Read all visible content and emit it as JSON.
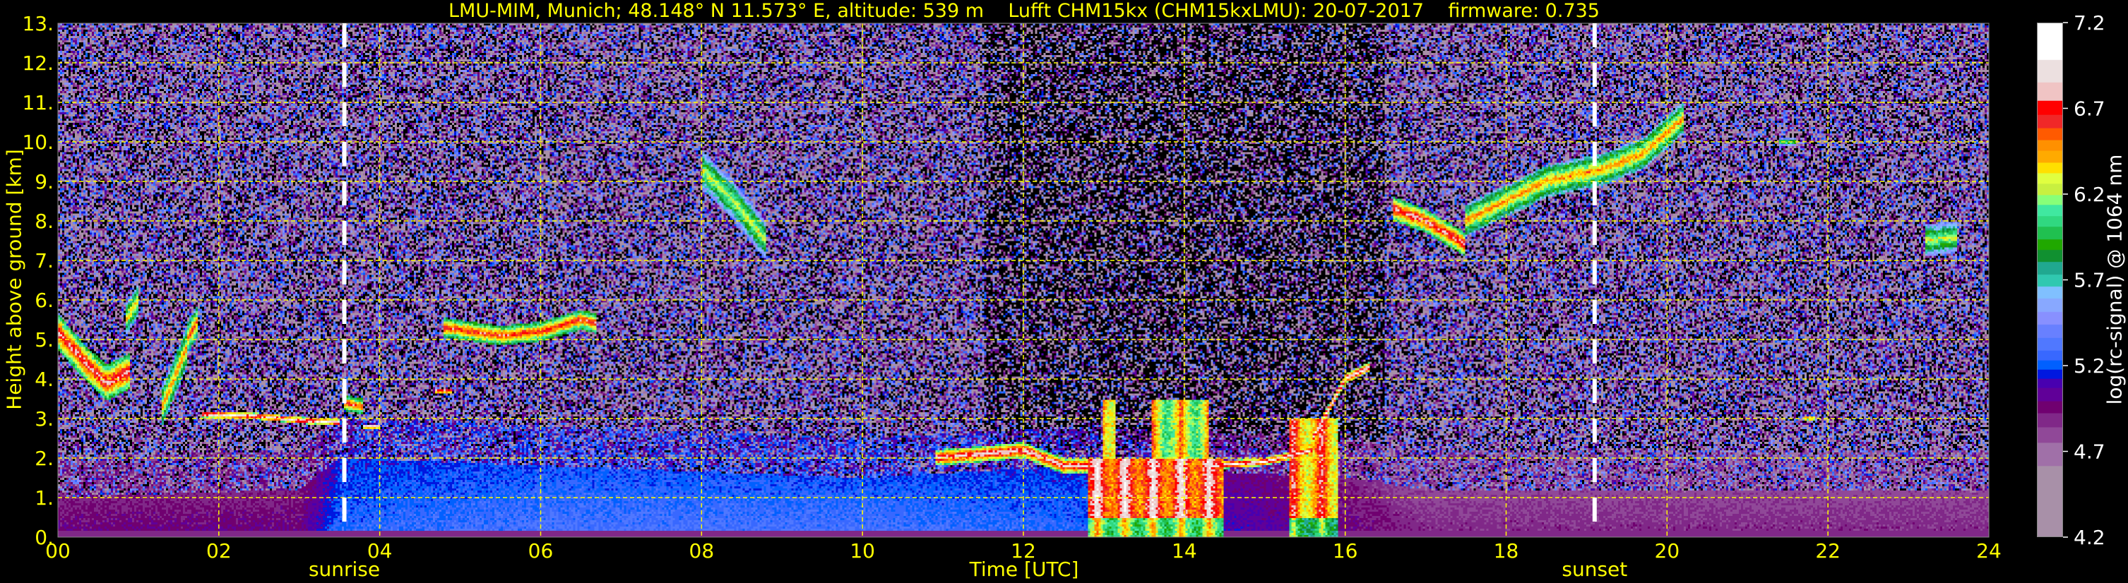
{
  "title": "LMU-MIM, Munich; 48.148° N 11.573° E, altitude: 539 m    Lufft CHM15kx (CHM15kxLMU): 20-07-2017    firmware: 0.735",
  "chart_data": {
    "type": "heatmap",
    "xlabel": "Time [UTC]",
    "ylabel": "Height above ground [km]",
    "xlim": [
      0,
      24
    ],
    "ylim": [
      0,
      13
    ],
    "xticks": [
      0,
      2,
      4,
      6,
      8,
      10,
      12,
      14,
      16,
      18,
      20,
      22,
      24
    ],
    "xtick_labels": [
      "00",
      "02",
      "04",
      "06",
      "08",
      "10",
      "12",
      "14",
      "16",
      "18",
      "20",
      "22",
      "24"
    ],
    "yticks": [
      0,
      1,
      2,
      3,
      4,
      5,
      6,
      7,
      8,
      9,
      10,
      11,
      12,
      13
    ],
    "ytick_labels": [
      "0.",
      "1.",
      "2.",
      "3.",
      "4.",
      "5.",
      "6.",
      "7.",
      "8.",
      "9.",
      "10.",
      "11.",
      "12.",
      "13."
    ],
    "grid": true,
    "grid_color": "#ffff00",
    "annotations": [
      {
        "label": "sunrise",
        "time": 3.56
      },
      {
        "label": "sunset",
        "time": 19.1
      }
    ],
    "colorbar": {
      "label": "log(rc-signal) @ 1064 nm",
      "range": [
        4.2,
        7.2
      ],
      "ticks": [
        4.2,
        4.7,
        5.2,
        5.7,
        6.2,
        6.7,
        7.2
      ],
      "tick_labels": [
        "4.2",
        "4.7",
        "5.2",
        "5.7",
        "6.2",
        "6.7",
        "7.2"
      ],
      "below_color": "#000000",
      "bins": [
        {
          "from": 6.987,
          "color": "#ffffff"
        },
        {
          "from": 6.857,
          "color": "#ece0e0"
        },
        {
          "from": 6.748,
          "color": "#f0c4c4"
        },
        {
          "from": 6.667,
          "color": "#ff0000"
        },
        {
          "from": 6.587,
          "color": "#f02828"
        },
        {
          "from": 6.52,
          "color": "#ff5a00"
        },
        {
          "from": 6.457,
          "color": "#ff9000"
        },
        {
          "from": 6.389,
          "color": "#ffaa00"
        },
        {
          "from": 6.324,
          "color": "#ffe000"
        },
        {
          "from": 6.265,
          "color": "#e0ff40"
        },
        {
          "from": 6.2,
          "color": "#c8f040"
        },
        {
          "from": 6.139,
          "color": "#88ff78"
        },
        {
          "from": 6.076,
          "color": "#40e8a0"
        },
        {
          "from": 6.013,
          "color": "#30d880"
        },
        {
          "from": 5.939,
          "color": "#20c050"
        },
        {
          "from": 5.878,
          "color": "#20a800"
        },
        {
          "from": 5.809,
          "color": "#109030"
        },
        {
          "from": 5.733,
          "color": "#20a890"
        },
        {
          "from": 5.661,
          "color": "#30c8b0"
        },
        {
          "from": 5.591,
          "color": "#80c0ff"
        },
        {
          "from": 5.513,
          "color": "#88a8ff"
        },
        {
          "from": 5.439,
          "color": "#8890ff"
        },
        {
          "from": 5.363,
          "color": "#6880ff"
        },
        {
          "from": 5.287,
          "color": "#5078ff"
        },
        {
          "from": 5.23,
          "color": "#3868ff"
        },
        {
          "from": 5.178,
          "color": "#0060ff"
        },
        {
          "from": 5.124,
          "color": "#0018e0"
        },
        {
          "from": 5.07,
          "color": "#4800b0"
        },
        {
          "from": 4.993,
          "color": "#600098"
        },
        {
          "from": 4.924,
          "color": "#700070"
        },
        {
          "from": 4.841,
          "color": "#802888"
        },
        {
          "from": 4.748,
          "color": "#904898"
        },
        {
          "from": 4.613,
          "color": "#a070a8"
        },
        {
          "from": 4.2,
          "color": "#a890a8"
        }
      ]
    },
    "boundary_layer": [
      [
        0,
        1.0,
        5.0
      ],
      [
        3,
        1.2,
        5.0
      ],
      [
        3.5,
        2.0,
        5.25
      ],
      [
        6,
        1.8,
        5.3
      ],
      [
        10,
        1.5,
        5.3
      ],
      [
        12.7,
        1.8,
        5.25
      ],
      [
        16,
        1.5,
        5.0
      ],
      [
        17,
        1.2,
        4.9
      ],
      [
        24,
        1.2,
        4.9
      ]
    ],
    "cloud_layers": [
      {
        "points": [
          [
            0,
            5.2
          ],
          [
            0.3,
            4.5
          ],
          [
            0.6,
            3.9
          ],
          [
            0.9,
            4.2
          ]
        ],
        "thickness": 0.45,
        "value": 6.8
      },
      {
        "points": [
          [
            0.85,
            5.5
          ],
          [
            1.0,
            6.0
          ]
        ],
        "thickness": 0.4,
        "value": 6.4
      },
      {
        "points": [
          [
            1.3,
            3.3
          ],
          [
            1.6,
            4.8
          ]
        ],
        "thickness": 0.5,
        "value": 6.5
      },
      {
        "points": [
          [
            1.6,
            5.0
          ],
          [
            1.75,
            5.5
          ]
        ],
        "thickness": 0.4,
        "value": 6.6
      },
      {
        "points": [
          [
            1.8,
            3.1
          ],
          [
            2.5,
            3.05
          ],
          [
            3.0,
            2.95
          ],
          [
            3.5,
            2.9
          ]
        ],
        "thickness": 0.08,
        "value": 7.0
      },
      {
        "points": [
          [
            3.55,
            3.4
          ],
          [
            3.8,
            3.3
          ]
        ],
        "thickness": 0.2,
        "value": 6.7
      },
      {
        "points": [
          [
            3.8,
            2.8
          ],
          [
            4.0,
            2.8
          ]
        ],
        "thickness": 0.06,
        "value": 7.0
      },
      {
        "points": [
          [
            4.7,
            3.7
          ],
          [
            4.9,
            3.7
          ]
        ],
        "thickness": 0.05,
        "value": 7.0
      },
      {
        "points": [
          [
            4.8,
            5.3
          ],
          [
            5.5,
            5.1
          ],
          [
            6.0,
            5.2
          ],
          [
            6.5,
            5.5
          ],
          [
            6.7,
            5.4
          ]
        ],
        "thickness": 0.25,
        "value": 6.7
      },
      {
        "points": [
          [
            8.0,
            9.3
          ],
          [
            8.4,
            8.5
          ],
          [
            8.8,
            7.5
          ]
        ],
        "thickness": 0.5,
        "value": 6.3
      },
      {
        "points": [
          [
            10.9,
            2.0
          ],
          [
            11.5,
            2.1
          ],
          [
            12.0,
            2.2
          ],
          [
            12.5,
            1.8
          ],
          [
            12.8,
            1.8
          ]
        ],
        "thickness": 0.2,
        "value": 6.9
      },
      {
        "points": [
          [
            14.3,
            1.8
          ],
          [
            15.0,
            1.9
          ],
          [
            15.6,
            2.2
          ]
        ],
        "thickness": 0.1,
        "value": 7.0
      },
      {
        "points": [
          [
            15.6,
            2.5
          ],
          [
            16.0,
            4.0
          ],
          [
            16.3,
            4.3
          ]
        ],
        "thickness": 0.12,
        "value": 7.0
      },
      {
        "points": [
          [
            16.6,
            8.3
          ],
          [
            17.0,
            8.0
          ],
          [
            17.5,
            7.4
          ]
        ],
        "thickness": 0.3,
        "value": 6.8
      },
      {
        "points": [
          [
            17.5,
            8.0
          ],
          [
            18.5,
            9.0
          ],
          [
            19.2,
            9.3
          ],
          [
            19.7,
            9.7
          ],
          [
            20.2,
            10.6
          ]
        ],
        "thickness": 0.4,
        "value": 6.5
      },
      {
        "points": [
          [
            21.4,
            10.0
          ],
          [
            21.6,
            10.0
          ]
        ],
        "thickness": 0.1,
        "value": 6.2
      },
      {
        "points": [
          [
            23.2,
            7.5
          ],
          [
            23.6,
            7.6
          ]
        ],
        "thickness": 0.4,
        "value": 6.3
      },
      {
        "points": [
          [
            21.7,
            3.0
          ],
          [
            21.85,
            3.0
          ]
        ],
        "thickness": 0.05,
        "value": 6.8
      }
    ],
    "convective_columns": [
      {
        "t0": 12.8,
        "t1": 14.5,
        "h0": 0,
        "h1": 2.0,
        "value": 6.9
      },
      {
        "t0": 13.0,
        "t1": 13.15,
        "h0": 0,
        "h1": 3.5,
        "value": 6.7
      },
      {
        "t0": 13.6,
        "t1": 14.3,
        "h0": 0,
        "h1": 3.5,
        "value": 6.5
      },
      {
        "t0": 15.3,
        "t1": 15.9,
        "h0": 0,
        "h1": 3.0,
        "value": 6.7
      }
    ]
  }
}
